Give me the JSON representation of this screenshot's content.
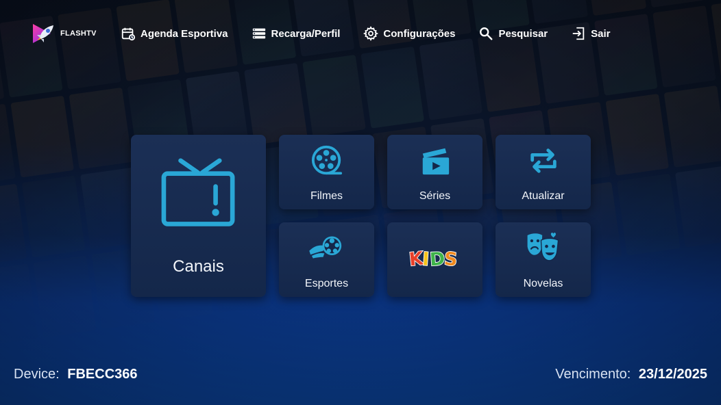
{
  "app": {
    "logo_text": "FLASHTV"
  },
  "nav": [
    {
      "id": "agenda",
      "label": "Agenda Esportiva",
      "icon": "calendar-icon"
    },
    {
      "id": "recarga",
      "label": "Recarga/Perfil",
      "icon": "list-icon"
    },
    {
      "id": "config",
      "label": "Configurações",
      "icon": "gear-icon"
    },
    {
      "id": "pesquisar",
      "label": "Pesquisar",
      "icon": "search-icon"
    },
    {
      "id": "sair",
      "label": "Sair",
      "icon": "exit-icon"
    }
  ],
  "tiles": {
    "canais": {
      "label": "Canais",
      "icon": "tv-icon"
    },
    "filmes": {
      "label": "Filmes",
      "icon": "film-reel-icon"
    },
    "series": {
      "label": "Séries",
      "icon": "clapperboard-icon"
    },
    "atualizar": {
      "label": "Atualizar",
      "icon": "refresh-icon"
    },
    "esportes": {
      "label": "Esportes",
      "icon": "soccer-ball-icon"
    },
    "kids": {
      "label": "KIDS",
      "icon": "kids-logo"
    },
    "novelas": {
      "label": "Novelas",
      "icon": "theater-masks-icon"
    }
  },
  "footer": {
    "device_label": "Device:",
    "device_value": "FBECC366",
    "expiry_label": "Vencimento:",
    "expiry_value": "23/12/2025"
  },
  "colors": {
    "accent": "#2aa7d6",
    "tile_bg": "#1a2d52",
    "bg_bottom": "#0a3c8a"
  }
}
